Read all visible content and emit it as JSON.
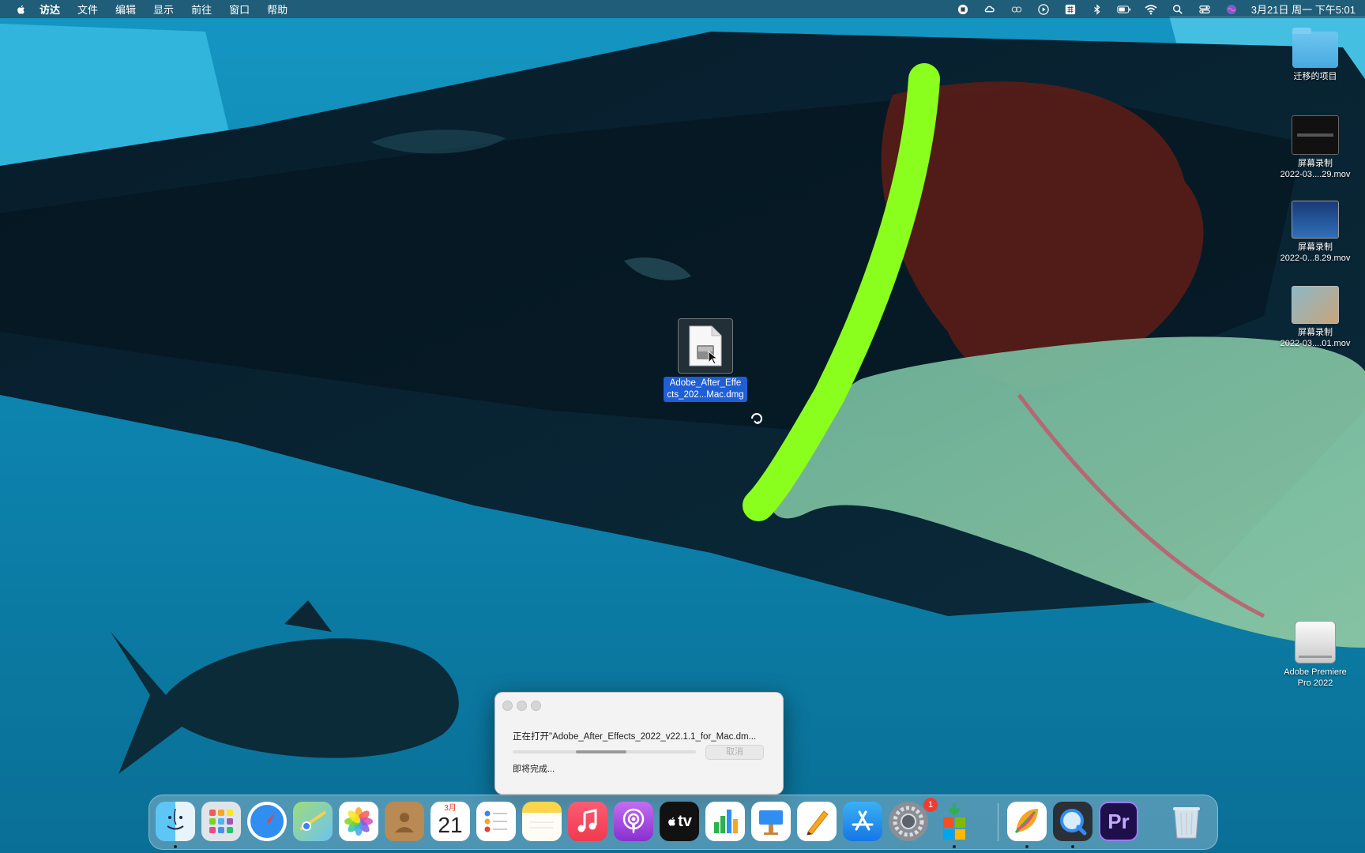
{
  "menubar": {
    "app_name": "访达",
    "items": [
      "文件",
      "编辑",
      "显示",
      "前往",
      "窗口",
      "帮助"
    ],
    "clock": "3月21日 周一 下午5:01"
  },
  "desktop": {
    "items": [
      {
        "label": "迁移的项目",
        "icon": "folder-icon"
      },
      {
        "label_line1": "屏幕录制",
        "label_line2": "2022-03....29.mov",
        "icon": "video-thumbnail"
      },
      {
        "label_line1": "屏幕录制",
        "label_line2": "2022-0...8.29.mov",
        "icon": "video-thumbnail"
      },
      {
        "label_line1": "屏幕录制",
        "label_line2": "2022-03....01.mov",
        "icon": "video-thumbnail"
      },
      {
        "label_line1": "Adobe Premiere",
        "label_line2": "Pro 2022",
        "icon": "drive-icon"
      }
    ],
    "selected_file": {
      "line1": "Adobe_After_Effe",
      "line2": "cts_202...Mac.dmg",
      "icon": "disk-image-icon"
    }
  },
  "dialog": {
    "title": "正在打开\"Adobe_After_Effects_2022_v22.1.1_for_Mac.dm...",
    "cancel_label": "取消",
    "status": "即将完成..."
  },
  "dock": {
    "calendar_month": "3月",
    "calendar_day": "21",
    "appletv_label": "tv",
    "premiere_label": "Pr",
    "settings_badge": "1",
    "apps": [
      "Finder",
      "Launchpad",
      "Safari",
      "Maps",
      "Photos",
      "Contacts",
      "Calendar",
      "Reminders",
      "Notes",
      "Music",
      "Podcasts",
      "TV",
      "Numbers",
      "Keynote",
      "Pages",
      "App Store",
      "System Preferences",
      "Microsoft Office",
      "Scrapbook",
      "QuickTime Player",
      "Adobe Premiere Pro",
      "Trash"
    ]
  },
  "colors": {
    "selection": "#1f5fd6",
    "water": "#0a6f93",
    "snorkel": "#8aff1e"
  }
}
